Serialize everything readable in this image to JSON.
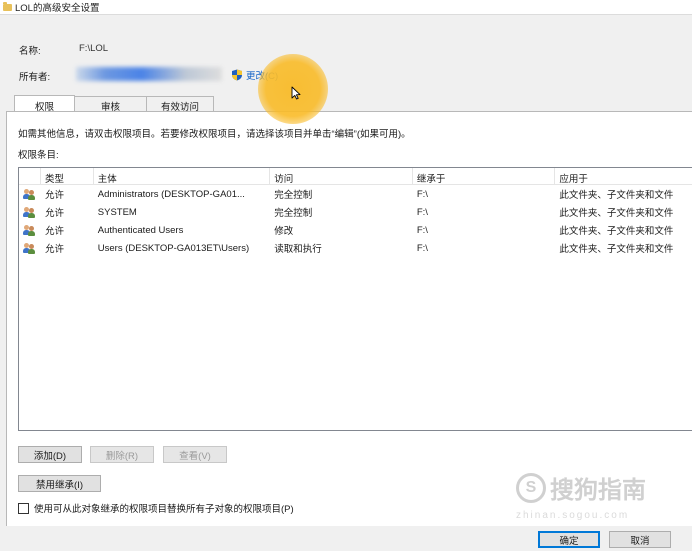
{
  "window": {
    "title": "LOL的高级安全设置"
  },
  "header": {
    "name_label": "名称:",
    "name_value": "F:\\LOL",
    "owner_label": "所有者:",
    "change_link": "更改(C)"
  },
  "tabs": [
    {
      "label": "权限",
      "active": true
    },
    {
      "label": "审核",
      "active": false
    },
    {
      "label": "有效访问",
      "active": false
    }
  ],
  "info_text": "如需其他信息，请双击权限项目。若要修改权限项目，请选择该项目并单击“编辑”(如果可用)。",
  "entries_label": "权限条目:",
  "table": {
    "columns": [
      "类型",
      "主体",
      "访问",
      "继承于",
      "应用于"
    ],
    "rows": [
      {
        "type": "允许",
        "principal": "Administrators (DESKTOP-GA01...",
        "access": "完全控制",
        "inherited": "F:\\",
        "applies": "此文件夹、子文件夹和文件"
      },
      {
        "type": "允许",
        "principal": "SYSTEM",
        "access": "完全控制",
        "inherited": "F:\\",
        "applies": "此文件夹、子文件夹和文件"
      },
      {
        "type": "允许",
        "principal": "Authenticated Users",
        "access": "修改",
        "inherited": "F:\\",
        "applies": "此文件夹、子文件夹和文件"
      },
      {
        "type": "允许",
        "principal": "Users (DESKTOP-GA013ET\\Users)",
        "access": "读取和执行",
        "inherited": "F:\\",
        "applies": "此文件夹、子文件夹和文件"
      }
    ]
  },
  "buttons": {
    "add": "添加(D)",
    "remove": "删除(R)",
    "view": "查看(V)",
    "disable_inheritance": "禁用继承(I)"
  },
  "replace_checkbox": {
    "label": "使用可从此对象继承的权限项目替换所有子对象的权限项目(P)",
    "checked": false
  },
  "footer": {
    "ok": "确定",
    "cancel": "取消"
  },
  "watermark": {
    "text": "搜狗指南",
    "sub": "zhinan.sogou.com"
  },
  "colors": {
    "link": "#1463c7",
    "highlight": "#f9bb28",
    "default_button_border": "#0078d7"
  }
}
